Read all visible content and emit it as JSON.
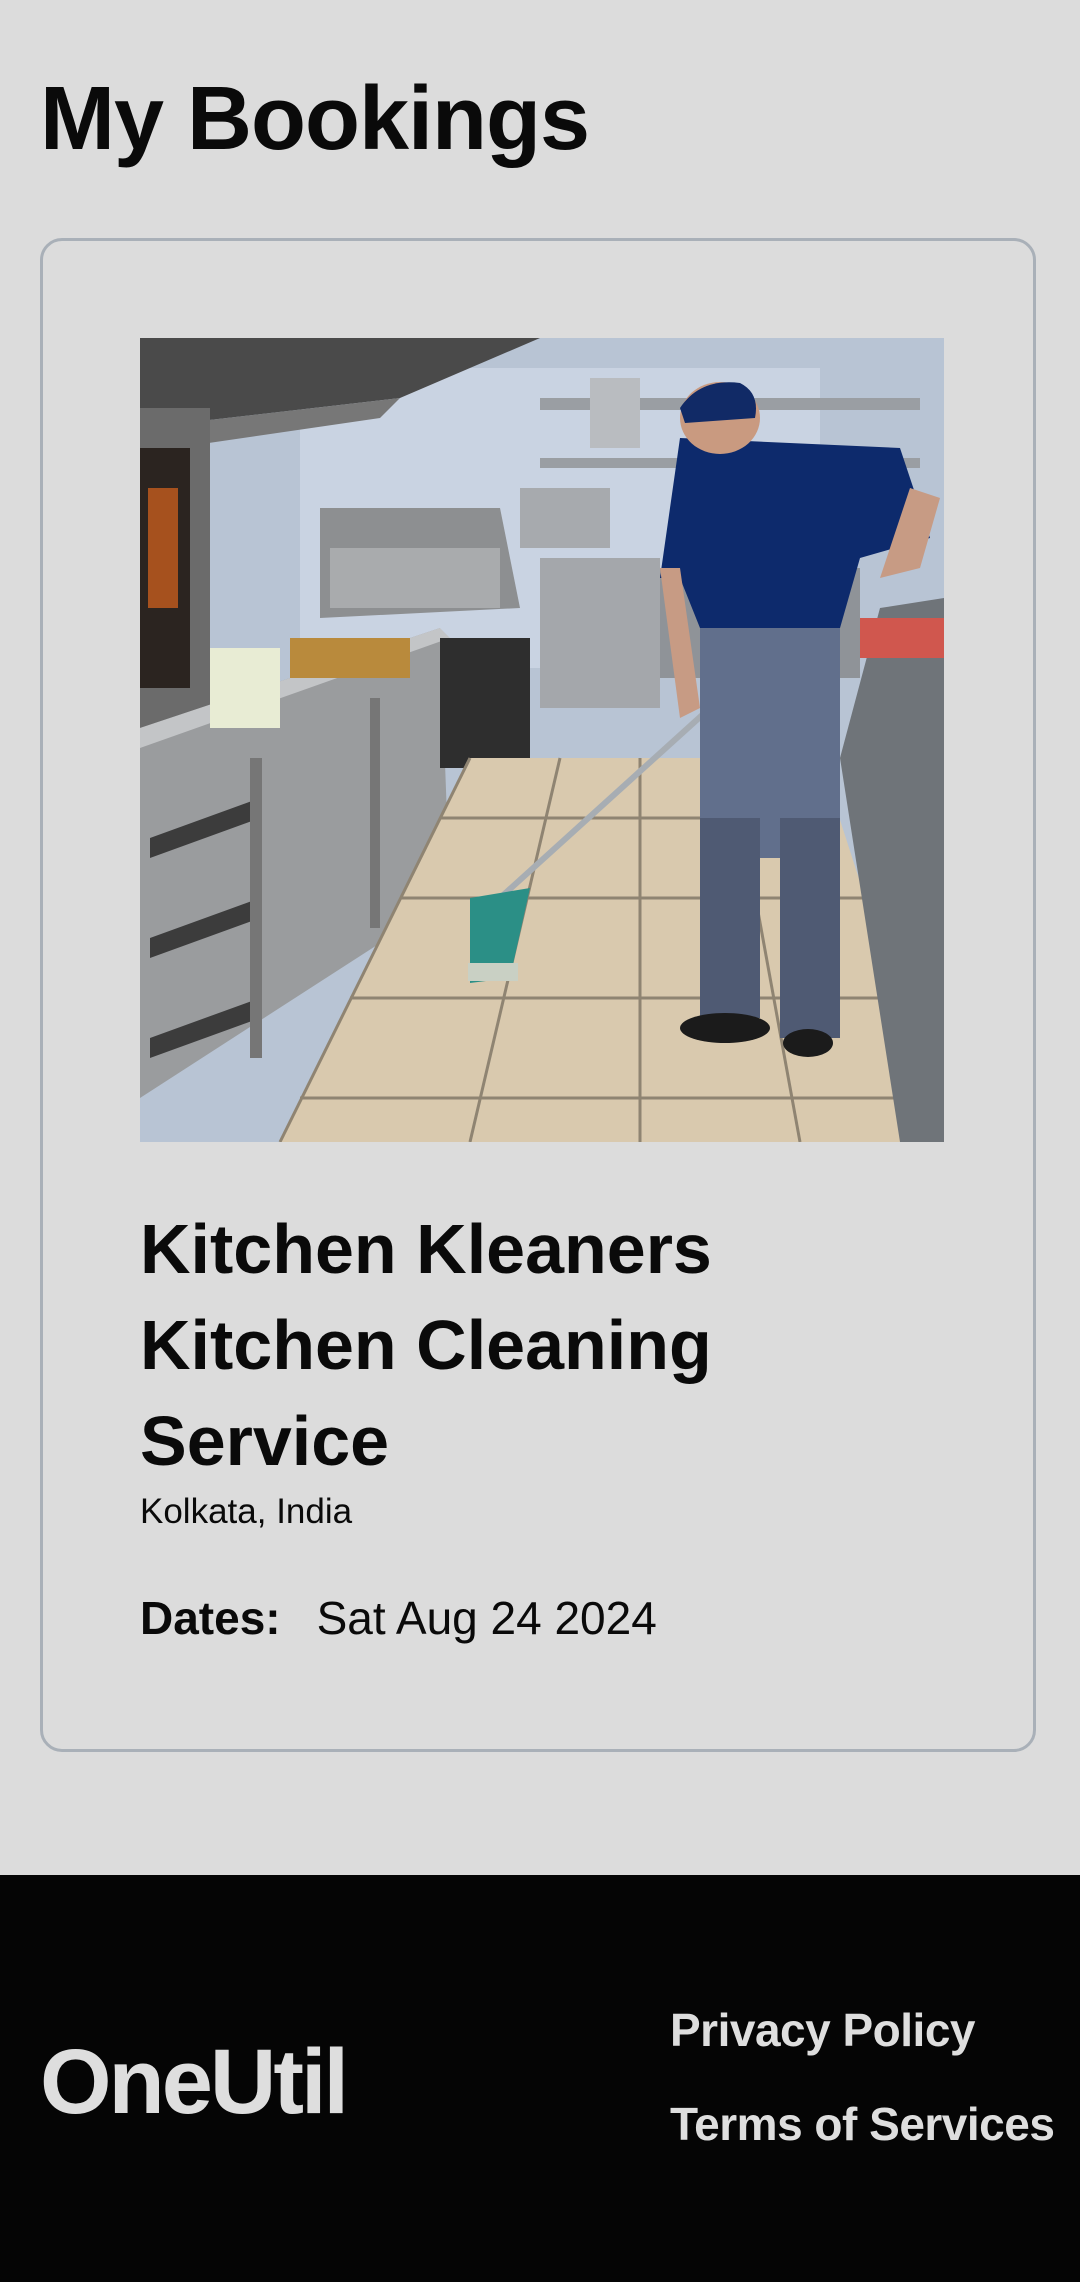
{
  "page": {
    "title": "My Bookings"
  },
  "booking": {
    "image_alt": "Kitchen Cleaning Service",
    "title": "Kitchen Kleaners Kitchen Cleaning Service",
    "location": "Kolkata, India",
    "dates_label": "Dates:",
    "dates_value": "Sat Aug 24 2024"
  },
  "footer": {
    "brand": "OneUtil",
    "links": [
      {
        "label": "Privacy Policy"
      },
      {
        "label": "Terms of Services"
      }
    ]
  },
  "colors": {
    "background": "#dcdcdc",
    "card_border": "#a9b0b8",
    "footer_background": "#050505",
    "footer_text": "#dedede"
  }
}
